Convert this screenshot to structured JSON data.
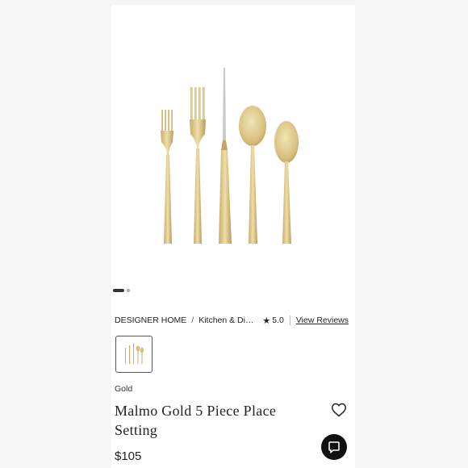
{
  "product": {
    "image_alt": "Gold flatware set",
    "carousel": {
      "active_index": 1,
      "count": 2
    },
    "breadcrumb": {
      "brand": "DESIGNER HOME",
      "separator": "/",
      "category": "Kitchen & Din…"
    },
    "rating": {
      "star_icon": "star-icon",
      "value": "5.0",
      "reviews_link": "View Reviews"
    },
    "swatch": {
      "selected_color": "Gold"
    },
    "title": "Malmo Gold 5 Piece Place Setting",
    "price": "$105",
    "colors": {
      "gold": "#d9c17f",
      "gold_dark": "#b89a55",
      "background": "#f6f6f6"
    }
  },
  "actions": {
    "favorite_icon": "heart-icon",
    "chat_icon": "chat-icon"
  }
}
